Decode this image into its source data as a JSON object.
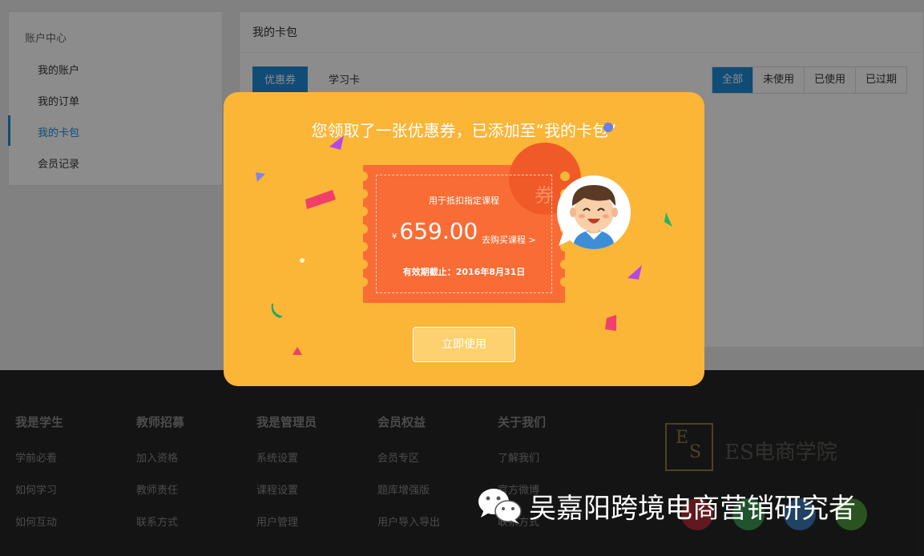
{
  "sidebar": {
    "heading": "账户中心",
    "items": [
      {
        "label": "我的账户"
      },
      {
        "label": "我的订单"
      },
      {
        "label": "我的卡包"
      },
      {
        "label": "会员记录"
      }
    ]
  },
  "main": {
    "title": "我的卡包",
    "tabs": [
      {
        "label": "优惠券"
      },
      {
        "label": "学习卡"
      }
    ],
    "filters": [
      {
        "label": "全部"
      },
      {
        "label": "未使用"
      },
      {
        "label": "已使用"
      },
      {
        "label": "已过期"
      }
    ]
  },
  "modal": {
    "title": "您领取了一张优惠券，已添加至“我的卡包”",
    "coupon": {
      "badge": "券",
      "description": "用于抵扣指定课程",
      "currency": "¥",
      "amount": "659.00",
      "buy_link": "去购买课程 >",
      "expiry": "有效期截止：2016年8月31日"
    },
    "button_label": "立即使用",
    "colors": {
      "background": "#fbb537",
      "coupon": "#f96c35"
    }
  },
  "footer": {
    "columns": [
      {
        "heading": "我是学生",
        "links": [
          "学前必看",
          "如何学习",
          "如何互动"
        ]
      },
      {
        "heading": "教师招募",
        "links": [
          "加入资格",
          "教师责任",
          "联系方式"
        ]
      },
      {
        "heading": "我是管理员",
        "links": [
          "系统设置",
          "课程设置",
          "用户管理"
        ]
      },
      {
        "heading": "会员权益",
        "links": [
          "会员专区",
          "题库增强版",
          "用户导入导出"
        ]
      },
      {
        "heading": "关于我们",
        "links": [
          "了解我们",
          "官方微博",
          "联系方式"
        ]
      }
    ],
    "logo_letters": [
      "E",
      "S"
    ],
    "brand": "ES电商学院",
    "social_icons": [
      "weibo-icon",
      "wechat-icon",
      "qq-icon",
      "mobile-icon"
    ]
  },
  "watermark": {
    "text": "吴嘉阳跨境电商营销研究者"
  }
}
